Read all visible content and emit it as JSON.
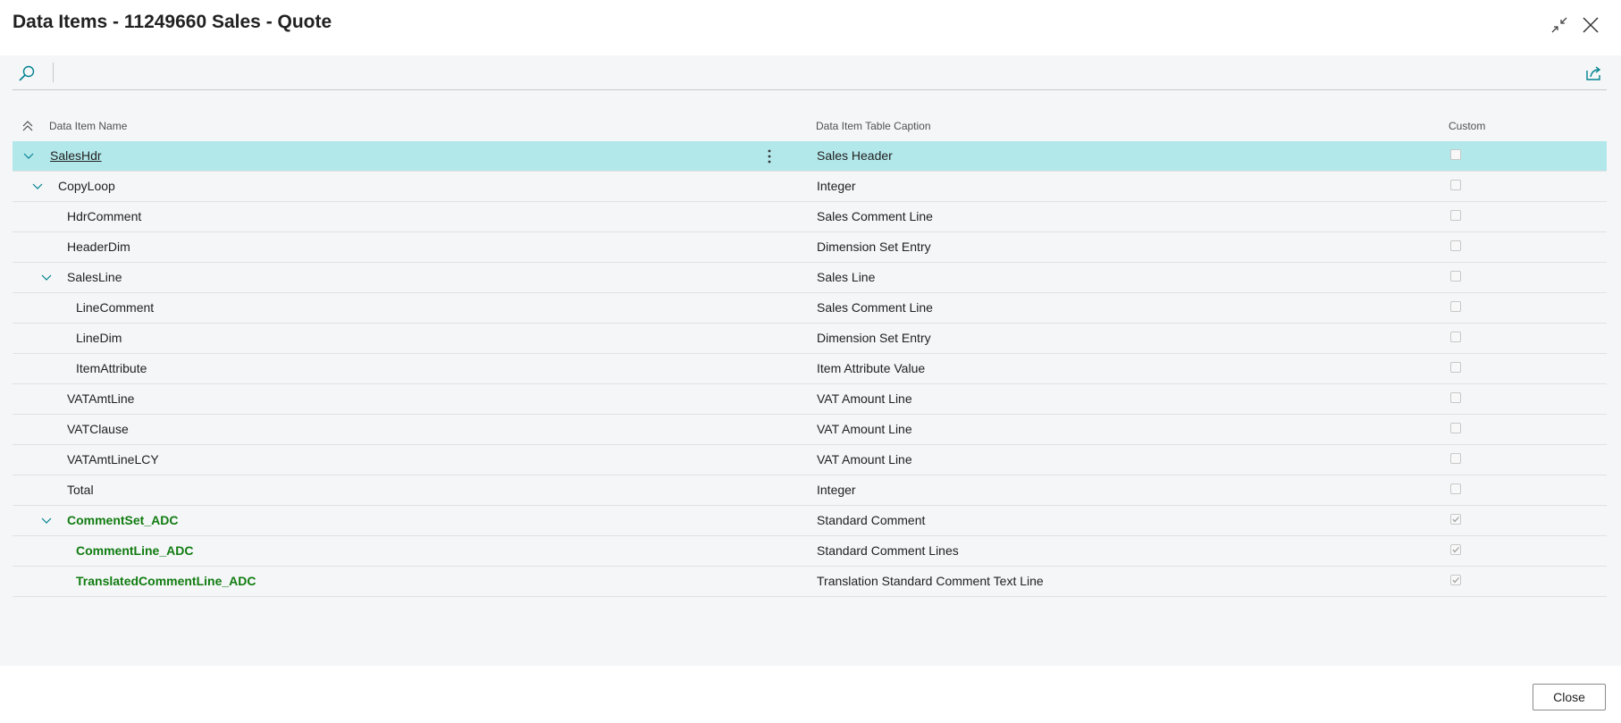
{
  "window": {
    "title": "Data Items - 11249660 Sales - Quote",
    "collapse_icon": "collapse-arrows-icon",
    "close_icon": "close-icon"
  },
  "toolbar": {
    "search_icon": "search-icon",
    "share_icon": "share-icon"
  },
  "columns": {
    "name": "Data Item Name",
    "caption": "Data Item Table Caption",
    "custom": "Custom"
  },
  "rows": [
    {
      "name": "SalesHdr",
      "caption": "Sales Header",
      "custom": false
    },
    {
      "name": "CopyLoop",
      "caption": "Integer",
      "custom": false
    },
    {
      "name": "HdrComment",
      "caption": "Sales Comment Line",
      "custom": false
    },
    {
      "name": "HeaderDim",
      "caption": "Dimension Set Entry",
      "custom": false
    },
    {
      "name": "SalesLine",
      "caption": "Sales Line",
      "custom": false
    },
    {
      "name": "LineComment",
      "caption": "Sales Comment Line",
      "custom": false
    },
    {
      "name": "LineDim",
      "caption": "Dimension Set Entry",
      "custom": false
    },
    {
      "name": "ItemAttribute",
      "caption": "Item Attribute Value",
      "custom": false
    },
    {
      "name": "VATAmtLine",
      "caption": "VAT Amount Line",
      "custom": false
    },
    {
      "name": "VATClause",
      "caption": "VAT Amount Line",
      "custom": false
    },
    {
      "name": "VATAmtLineLCY",
      "caption": "VAT Amount Line",
      "custom": false
    },
    {
      "name": "Total",
      "caption": "Integer",
      "custom": false
    },
    {
      "name": "CommentSet_ADC",
      "caption": "Standard Comment",
      "custom": true
    },
    {
      "name": "CommentLine_ADC",
      "caption": "Standard Comment Lines",
      "custom": true
    },
    {
      "name": "TranslatedCommentLine_ADC",
      "caption": "Translation Standard Comment Text Line",
      "custom": true
    }
  ],
  "footer": {
    "close_label": "Close"
  },
  "colors": {
    "selected_row": "#b3e8eb",
    "custom_text": "#107c10",
    "accent": "#00828f"
  }
}
